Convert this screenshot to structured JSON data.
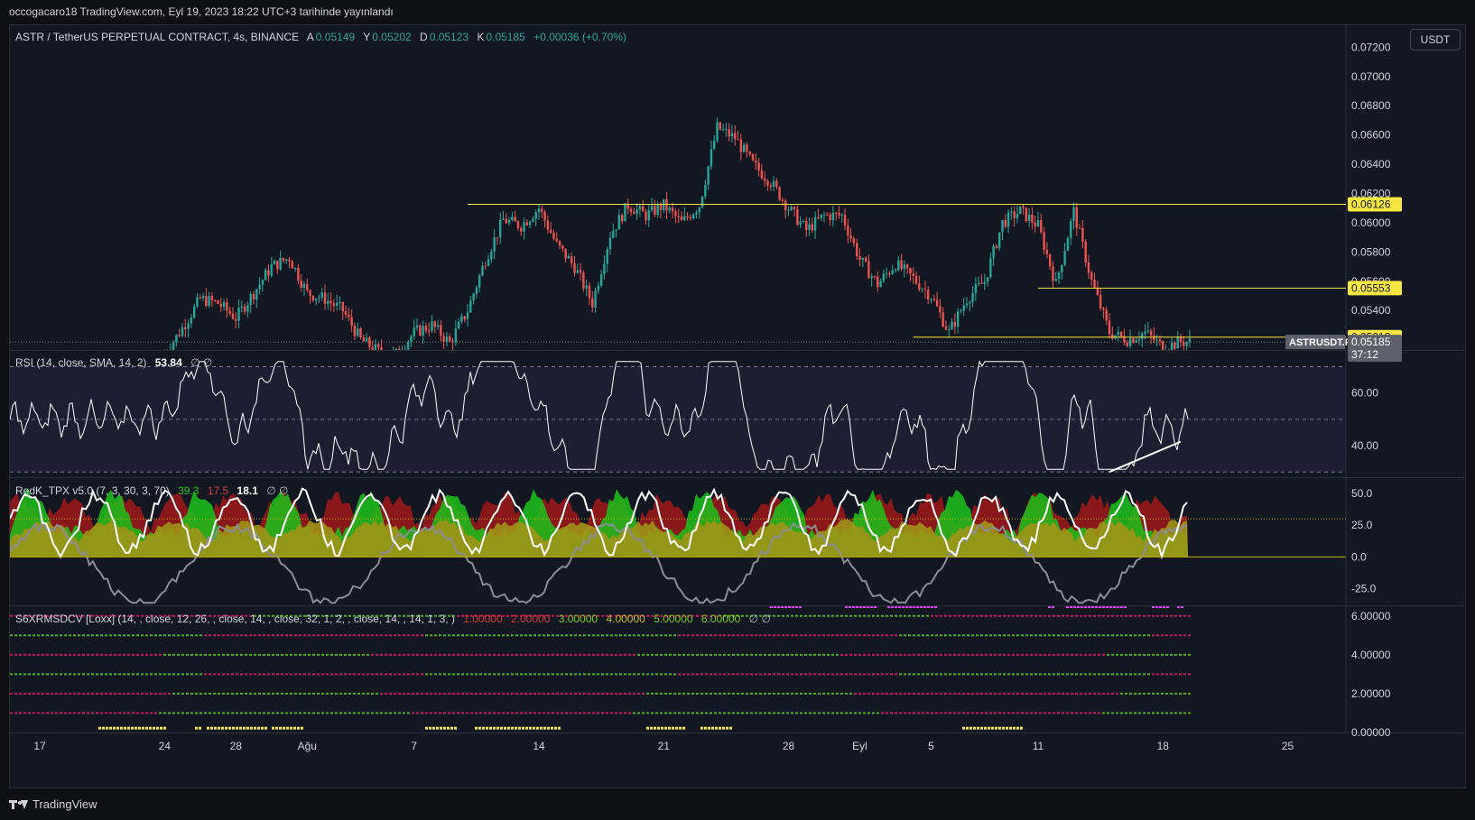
{
  "header": {
    "caption": "occogacaro18 TradingView.com, Eyl 19, 2023 18:22 UTC+3 tarihinde yayınlandı"
  },
  "symbol_legend": {
    "title": "ASTR / TetherUS PERPETUAL CONTRACT, 4s, BINANCE",
    "open_label": "A",
    "open": "0.05149",
    "high_label": "Y",
    "high": "0.05202",
    "low_label": "D",
    "low": "0.05123",
    "close_label": "K",
    "close": "0.05185",
    "change": "+0.00036 (+0.70%)"
  },
  "currency_button": "USDT",
  "colors": {
    "background": "#131722",
    "page": "#0f1014",
    "up": "#26a69a",
    "down": "#ef5350",
    "level_line": "#f5e642",
    "grid": "#2a2e39",
    "text": "#d1d4dc",
    "rsi_band": "#7e57c2",
    "tpx_green": "#1cc21c",
    "tpx_red": "#a01818",
    "tpx_olive": "#a09418"
  },
  "chart_data": [
    {
      "type": "candlestick",
      "name": "ASTR / TetherUS PERPETUAL CONTRACT",
      "interval": "4s",
      "exchange": "BINANCE",
      "x_tick_labels": [
        "17",
        "24",
        "28",
        "Ağu",
        "7",
        "14",
        "21",
        "28",
        "Eyl",
        "5",
        "11",
        "18",
        "25"
      ],
      "x_ticks": [
        {
          "label": "17",
          "date": "2023-07-17"
        },
        {
          "label": "24",
          "date": "2023-07-24"
        },
        {
          "label": "28",
          "date": "2023-07-28"
        },
        {
          "label": "Ağu",
          "date": "2023-08-01"
        },
        {
          "label": "7",
          "date": "2023-08-07"
        },
        {
          "label": "14",
          "date": "2023-08-14"
        },
        {
          "label": "21",
          "date": "2023-08-21"
        },
        {
          "label": "28",
          "date": "2023-08-28"
        },
        {
          "label": "Eyl",
          "date": "2023-09-01"
        },
        {
          "label": "5",
          "date": "2023-09-05"
        },
        {
          "label": "11",
          "date": "2023-09-11"
        },
        {
          "label": "18",
          "date": "2023-09-18"
        },
        {
          "label": "25",
          "date": "2023-09-25"
        }
      ],
      "y_tick_labels": [
        "0.07200",
        "0.07000",
        "0.06800",
        "0.06600",
        "0.06400",
        "0.06200",
        "0.06000",
        "0.05800",
        "0.05600",
        "0.05400"
      ],
      "ylim": [
        0.0513,
        0.0735
      ],
      "price_path": [
        [
          "2023-07-24",
          0.051
        ],
        [
          "2023-07-25",
          0.0528
        ],
        [
          "2023-07-26",
          0.0548
        ],
        [
          "2023-07-27",
          0.0545
        ],
        [
          "2023-07-28",
          0.0535
        ],
        [
          "2023-07-29",
          0.0552
        ],
        [
          "2023-07-30",
          0.057
        ],
        [
          "2023-07-31",
          0.0576
        ],
        [
          "2023-08-01",
          0.0552
        ],
        [
          "2023-08-02",
          0.0548
        ],
        [
          "2023-08-03",
          0.054
        ],
        [
          "2023-08-04",
          0.052
        ],
        [
          "2023-08-05",
          0.0512
        ],
        [
          "2023-08-06",
          0.051
        ],
        [
          "2023-08-07",
          0.0525
        ],
        [
          "2023-08-08",
          0.053
        ],
        [
          "2023-08-09",
          0.0518
        ],
        [
          "2023-08-10",
          0.054
        ],
        [
          "2023-08-11",
          0.0575
        ],
        [
          "2023-08-12",
          0.0602
        ],
        [
          "2023-08-13",
          0.0598
        ],
        [
          "2023-08-14",
          0.061
        ],
        [
          "2023-08-15",
          0.0585
        ],
        [
          "2023-08-16",
          0.057
        ],
        [
          "2023-08-17",
          0.0545
        ],
        [
          "2023-08-18",
          0.0592
        ],
        [
          "2023-08-19",
          0.0612
        ],
        [
          "2023-08-20",
          0.0605
        ],
        [
          "2023-08-21",
          0.0612
        ],
        [
          "2023-08-22",
          0.06
        ],
        [
          "2023-08-23",
          0.0612
        ],
        [
          "2023-08-24",
          0.0665
        ],
        [
          "2023-08-25",
          0.0658
        ],
        [
          "2023-08-26",
          0.064
        ],
        [
          "2023-08-27",
          0.0628
        ],
        [
          "2023-08-28",
          0.061
        ],
        [
          "2023-08-29",
          0.0595
        ],
        [
          "2023-08-30",
          0.0605
        ],
        [
          "2023-08-31",
          0.0605
        ],
        [
          "2023-09-01",
          0.0575
        ],
        [
          "2023-09-02",
          0.0558
        ],
        [
          "2023-09-03",
          0.0572
        ],
        [
          "2023-09-04",
          0.0562
        ],
        [
          "2023-09-05",
          0.055
        ],
        [
          "2023-09-06",
          0.0525
        ],
        [
          "2023-09-07",
          0.0548
        ],
        [
          "2023-09-08",
          0.056
        ],
        [
          "2023-09-09",
          0.06
        ],
        [
          "2023-09-10",
          0.0608
        ],
        [
          "2023-09-11",
          0.0598
        ],
        [
          "2023-09-12",
          0.0558
        ],
        [
          "2023-09-13",
          0.0608
        ],
        [
          "2023-09-14",
          0.056
        ],
        [
          "2023-09-15",
          0.0525
        ],
        [
          "2023-09-16",
          0.052
        ],
        [
          "2023-09-17",
          0.0525
        ],
        [
          "2023-09-18",
          0.0515
        ],
        [
          "2023-09-19",
          0.05185
        ]
      ],
      "horizontal_levels": [
        {
          "value": 0.06126,
          "label": "0.06126",
          "from": "2023-08-10"
        },
        {
          "value": 0.05553,
          "label": "0.05553",
          "from": "2023-09-11"
        },
        {
          "value": 0.05218,
          "label": "0.05218",
          "from": "2023-09-04"
        }
      ],
      "last_price": {
        "symbol": "ASTRUSDT.P",
        "value": "0.05185",
        "countdown": "37:12"
      }
    },
    {
      "type": "line",
      "name": "RSI",
      "legend": "RSI (14, close, SMA, 14, 2)",
      "value": "53.84",
      "extra": "∅ ∅",
      "y_tick_labels": [
        "60.00",
        "40.00"
      ],
      "ylim": [
        28,
        76
      ],
      "bands": [
        70,
        50,
        30
      ],
      "trendline": [
        [
          "2023-09-15",
          30
        ],
        [
          "2023-09-19",
          41.5
        ]
      ]
    },
    {
      "type": "area",
      "name": "RedK_TPX",
      "legend": "RedK_TPX v5.0 (7, 3, 30, 3, 70)",
      "values": [
        {
          "text": "39.3",
          "color": "#1cc21c"
        },
        {
          "text": "17.5",
          "color": "#d83b3b"
        },
        {
          "text": "18.1",
          "color": "#ffffff"
        }
      ],
      "extra": "∅ ∅",
      "y_tick_labels": [
        "50.0",
        "25.0",
        "0.0",
        "-25.0"
      ],
      "ylim": [
        -38,
        62
      ],
      "threshold": 30
    },
    {
      "type": "heatmap",
      "name": "S6XRMSDCV [Loxx]",
      "legend": "S6XRMSDCV [Loxx] (14, , close, 12, 26, , close, 14, , close, 32, 1, 2, , close, 14, , 14, 1, 3, )",
      "values": [
        {
          "text": "1.00000",
          "color": "#d83b3b"
        },
        {
          "text": "2.00000",
          "color": "#d83b3b"
        },
        {
          "text": "3.00000",
          "color": "#7ad11a"
        },
        {
          "text": "4.00000",
          "color": "#c2c22a"
        },
        {
          "text": "5.00000",
          "color": "#7ad11a"
        },
        {
          "text": "6.00000",
          "color": "#7ad11a"
        }
      ],
      "extra": "∅ ∅",
      "y_tick_labels": [
        "6.00000",
        "4.00000",
        "2.00000",
        "0.00000"
      ],
      "ylim": [
        0,
        6.5
      ],
      "rows": [
        1,
        2,
        3,
        4,
        5,
        6
      ]
    }
  ],
  "footer": {
    "brand": "TradingView"
  }
}
